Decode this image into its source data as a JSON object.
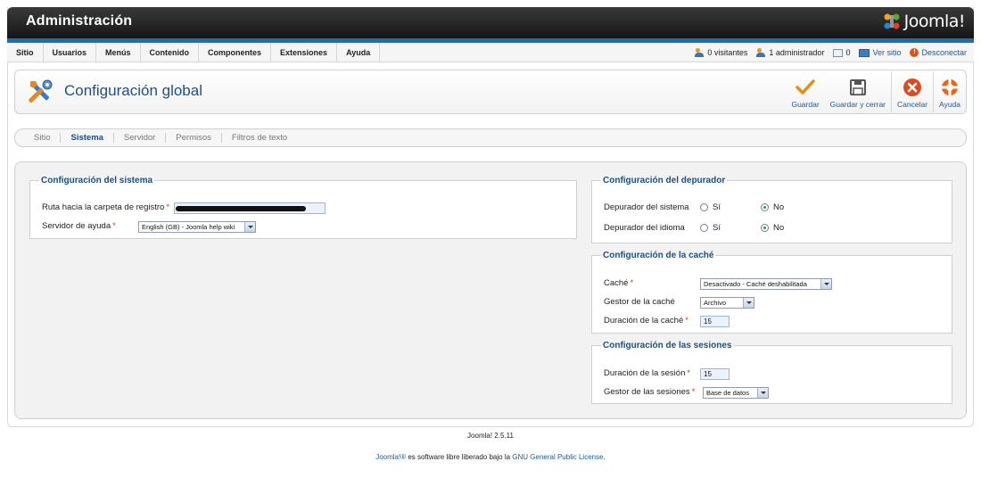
{
  "header": {
    "title": "Administración",
    "logo_text": "Joomla!"
  },
  "menu": [
    "Sitio",
    "Usuarios",
    "Menús",
    "Contenido",
    "Componentes",
    "Extensiones",
    "Ayuda"
  ],
  "status": {
    "visitors": "0 visitantes",
    "admins": "1 administrador",
    "messages": "0",
    "view_site": "Ver sitio",
    "logout": "Desconectar"
  },
  "toolbar": {
    "title": "Configuración global",
    "save": "Guardar",
    "save_close": "Guardar y cerrar",
    "cancel": "Cancelar",
    "help": "Ayuda"
  },
  "tabs": [
    {
      "label": "Sitio",
      "active": false
    },
    {
      "label": "Sistema",
      "active": true
    },
    {
      "label": "Servidor",
      "active": false
    },
    {
      "label": "Permisos",
      "active": false
    },
    {
      "label": "Filtros de texto",
      "active": false
    }
  ],
  "system": {
    "legend": "Configuración del sistema",
    "log_path_label": "Ruta hacia la carpeta de registro",
    "help_server_label": "Servidor de ayuda",
    "help_server_value": "English (GB) - Joomla help wiki"
  },
  "debug": {
    "legend": "Configuración del depurador",
    "system_label": "Depurador del sistema",
    "language_label": "Depurador del idioma",
    "yes": "Sí",
    "no": "No",
    "system_value": "No",
    "language_value": "No"
  },
  "cache": {
    "legend": "Configuración de la caché",
    "cache_label": "Caché",
    "cache_value": "Desactivado - Caché deshabilitada",
    "handler_label": "Gestor de la caché",
    "handler_value": "Archivo",
    "time_label": "Duración de la caché",
    "time_value": "15"
  },
  "session": {
    "legend": "Configuración de las sesiones",
    "lifetime_label": "Duración de la sesión",
    "lifetime_value": "15",
    "handler_label": "Gestor de las sesiones",
    "handler_value": "Base de datos"
  },
  "footer": {
    "version": "Joomla! 2.5.11",
    "license_link1": "Joomla!®",
    "license_text": " es software libre liberado bajo la ",
    "license_link2": "GNU General Public License",
    "license_end": "."
  },
  "colors": {
    "accent": "#1d6fb0",
    "title": "#1e4f86",
    "header_dark": "#161616"
  }
}
